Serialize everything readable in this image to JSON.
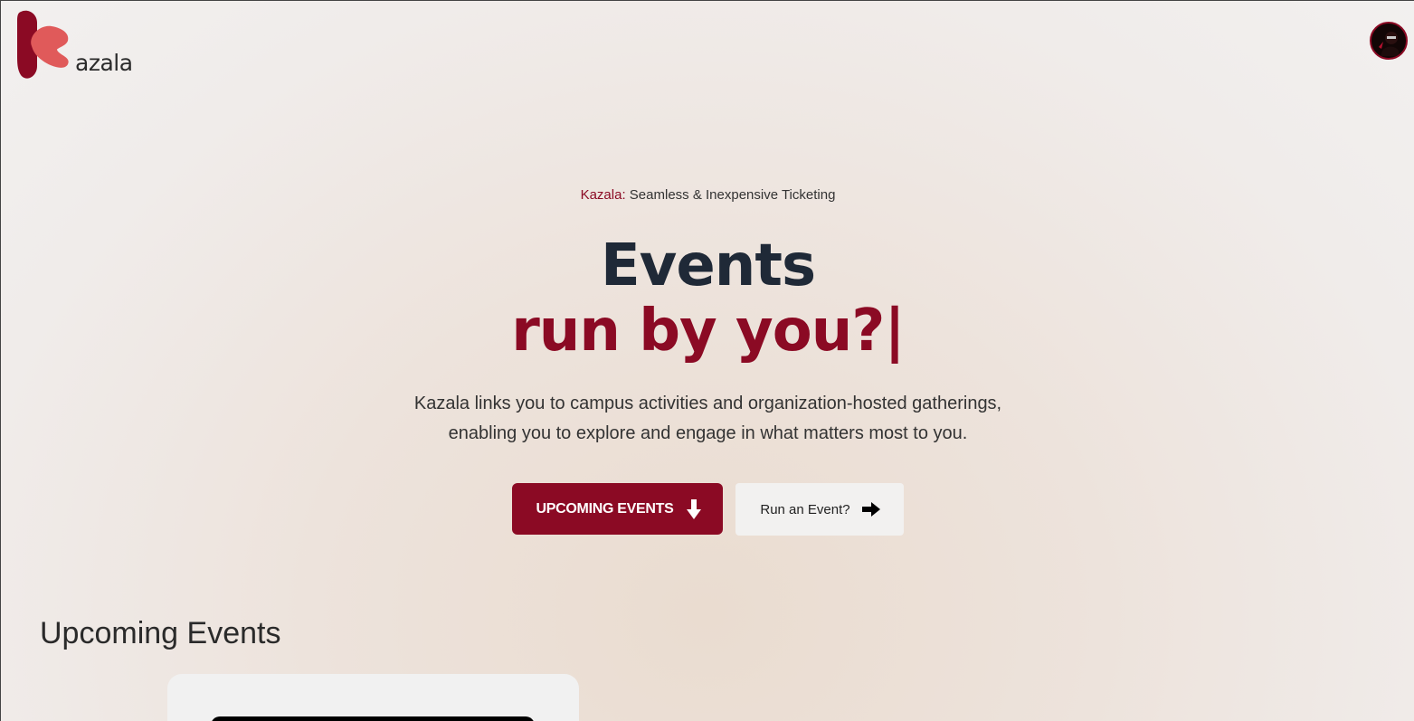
{
  "header": {
    "logo_text": "azala",
    "logo_icon": "kazala-k-logo",
    "avatar_icon": "user-avatar"
  },
  "hero": {
    "tagline_brand": "Kazala:",
    "tagline_text": "Seamless & Inexpensive Ticketing",
    "headline_line1": "Events",
    "headline_line2": "run by you?|",
    "description_line1": "Kazala links you to campus activities and organization-hosted gatherings,",
    "description_line2": "enabling you to explore and engage in what matters most to you.",
    "primary_button_label": "UPCOMING EVENTS",
    "primary_button_icon": "arrow-down-icon",
    "secondary_button_label": "Run an Event?",
    "secondary_button_icon": "arrow-right-icon"
  },
  "events_section": {
    "title": "Upcoming Events"
  },
  "colors": {
    "brand": "#8b0a24",
    "brand_light": "#e05a5a",
    "heading": "#1f2937",
    "text": "#333333"
  }
}
